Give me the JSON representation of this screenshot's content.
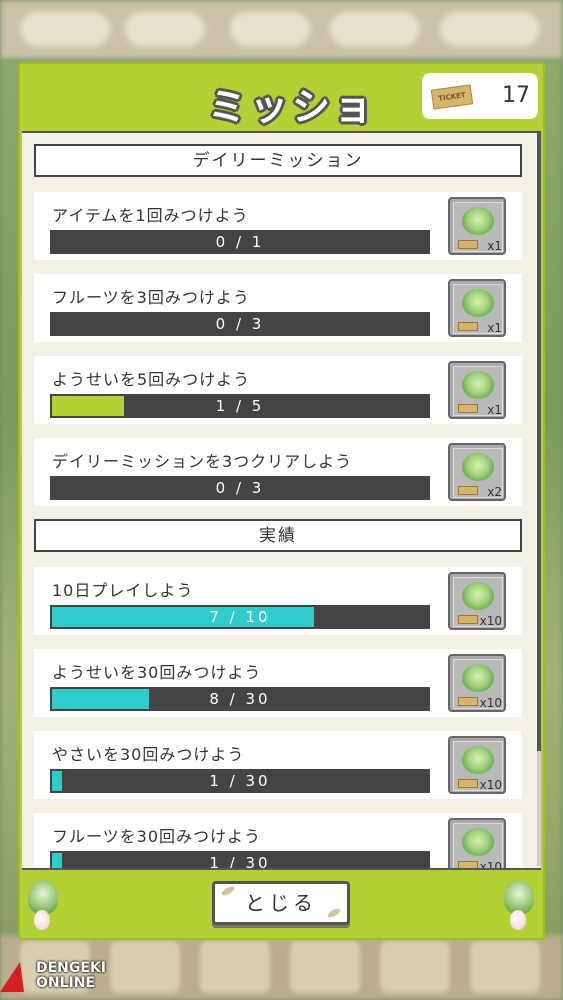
{
  "dialog": {
    "title": "ミッション",
    "ticket_icon_label": "TICKET",
    "ticket_count": "17",
    "close_label": "とじる"
  },
  "daily": {
    "header": "デイリーミッション",
    "missions": [
      {
        "label": "アイテムを1回みつけよう",
        "progress_text": "0 / 1",
        "progress": 0.0,
        "reward_qty": "x1"
      },
      {
        "label": "フルーツを3回みつけよう",
        "progress_text": "0 / 3",
        "progress": 0.0,
        "reward_qty": "x1"
      },
      {
        "label": "ようせいを5回みつけよう",
        "progress_text": "1 / 5",
        "progress": 0.2,
        "reward_qty": "x1"
      },
      {
        "label": "デイリーミッションを3つクリアしよう",
        "progress_text": "0 / 3",
        "progress": 0.0,
        "reward_qty": "x2"
      }
    ]
  },
  "achievements": {
    "header": "実績",
    "missions": [
      {
        "label": "10日プレイしよう",
        "progress_text": "7 / 10",
        "progress": 0.7,
        "reward_qty": "x10"
      },
      {
        "label": "ようせいを30回みつけよう",
        "progress_text": "8 / 30",
        "progress": 0.267,
        "reward_qty": "x10"
      },
      {
        "label": "やさいを30回みつけよう",
        "progress_text": "1 / 30",
        "progress": 0.033,
        "reward_qty": "x10"
      },
      {
        "label": "フルーツを30回みつけよう",
        "progress_text": "1 / 30",
        "progress": 0.033,
        "reward_qty": "x10"
      }
    ]
  },
  "watermark": {
    "line1": "DENGEKI",
    "line2": "ONLINE"
  },
  "colors": {
    "panel": "#b3d034",
    "daily_fill": "#b3d034",
    "achievement_fill": "#2fcccc",
    "bar_track": "#444444"
  }
}
